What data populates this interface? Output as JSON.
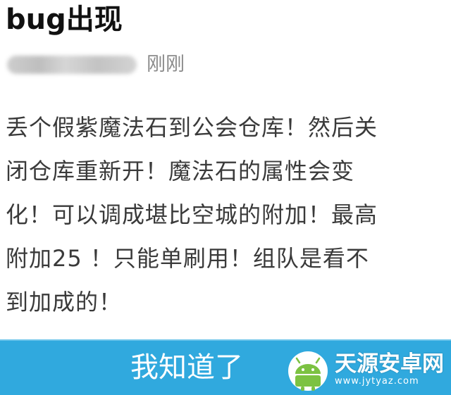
{
  "post": {
    "title": "bug出现",
    "author": "",
    "timestamp": "刚刚",
    "body": "丢个假紫魔法石到公会仓库！然后关\n闭仓库重新开！魔法石的属性会变\n化！可以调成堪比空城的附加！最高\n附加25 ！只能单刷用！组队是看不\n到加成的！"
  },
  "dialog": {
    "confirm_label": "我知道了"
  },
  "watermark": {
    "title": "天源安卓网",
    "url": "www.jytyaz.com",
    "logo_icon": "android-logo-icon"
  },
  "colors": {
    "button_bg": "#30a9de",
    "title_text": "#111111",
    "body_text": "#3a3a3a",
    "timestamp_text": "#8a8a8a"
  }
}
